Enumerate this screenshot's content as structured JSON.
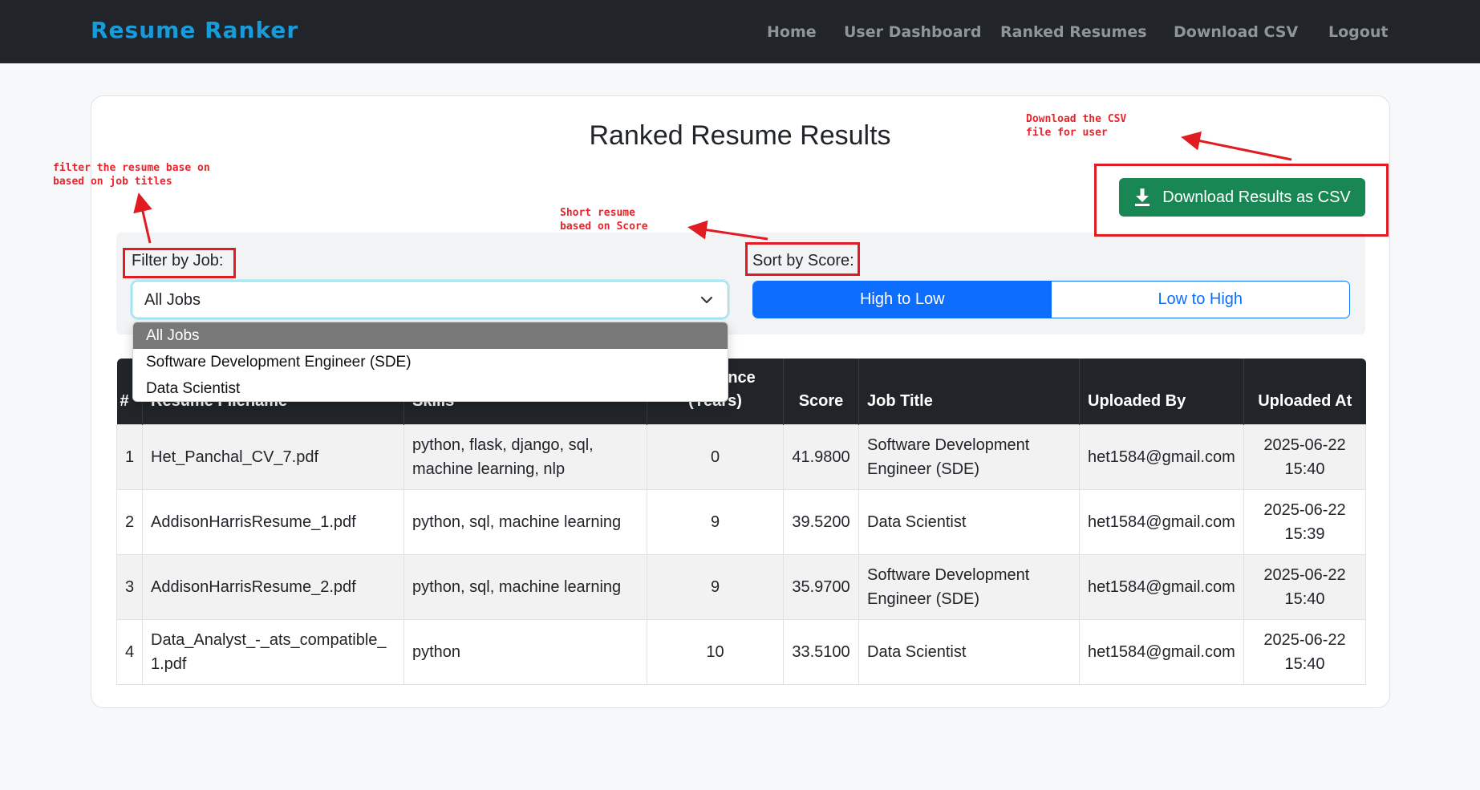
{
  "nav": {
    "brand": "Resume Ranker",
    "links": [
      "Home",
      "User Dashboard",
      "Ranked Resumes",
      "Download CSV",
      "Logout"
    ]
  },
  "page": {
    "title": "Ranked Resume Results",
    "download_button": "Download Results as CSV"
  },
  "filter": {
    "label": "Filter by Job:",
    "selected": "All Jobs",
    "options": [
      "All Jobs",
      "Software Development Engineer (SDE)",
      "Data Scientist"
    ]
  },
  "sort": {
    "label": "Sort by Score:",
    "high_to_low": "High to Low",
    "low_to_high": "Low to High",
    "active": "High to Low"
  },
  "table": {
    "headers": {
      "num": "#",
      "filename": "Resume Filename",
      "skills": "Skills",
      "experience_top": "ence",
      "experience_bottom": "(Years)",
      "score": "Score",
      "job_title": "Job Title",
      "uploaded_by": "Uploaded By",
      "uploaded_at": "Uploaded At"
    },
    "rows": [
      {
        "num": "1",
        "filename": "Het_Panchal_CV_7.pdf",
        "skills": "python, flask, django, sql, machine learning, nlp",
        "experience": "0",
        "score": "41.9800",
        "job_title": "Software Development Engineer (SDE)",
        "uploaded_by": "het1584@gmail.com",
        "uploaded_at": "2025-06-22 15:40"
      },
      {
        "num": "2",
        "filename": "AddisonHarrisResume_1.pdf",
        "skills": "python, sql, machine learning",
        "experience": "9",
        "score": "39.5200",
        "job_title": "Data Scientist",
        "uploaded_by": "het1584@gmail.com",
        "uploaded_at": "2025-06-22 15:39"
      },
      {
        "num": "3",
        "filename": "AddisonHarrisResume_2.pdf",
        "skills": "python, sql, machine learning",
        "experience": "9",
        "score": "35.9700",
        "job_title": "Software Development Engineer (SDE)",
        "uploaded_by": "het1584@gmail.com",
        "uploaded_at": "2025-06-22 15:40"
      },
      {
        "num": "4",
        "filename": "Data_Analyst_-_ats_compatible_1.pdf",
        "skills": "python",
        "experience": "10",
        "score": "33.5100",
        "job_title": "Data Scientist",
        "uploaded_by": "het1584@gmail.com",
        "uploaded_at": "2025-06-22 15:40"
      }
    ]
  },
  "annotations": {
    "filter_note": "filter the resume base on\nbased on job titles",
    "sort_note": "Short resume\nbased on Score",
    "download_note": "Download the CSV\nfile for user",
    "color": "#e11b22"
  },
  "colors": {
    "navbar": "#212529",
    "brand": "#1a9bd9",
    "primary": "#0d6efd",
    "success": "#198754"
  }
}
